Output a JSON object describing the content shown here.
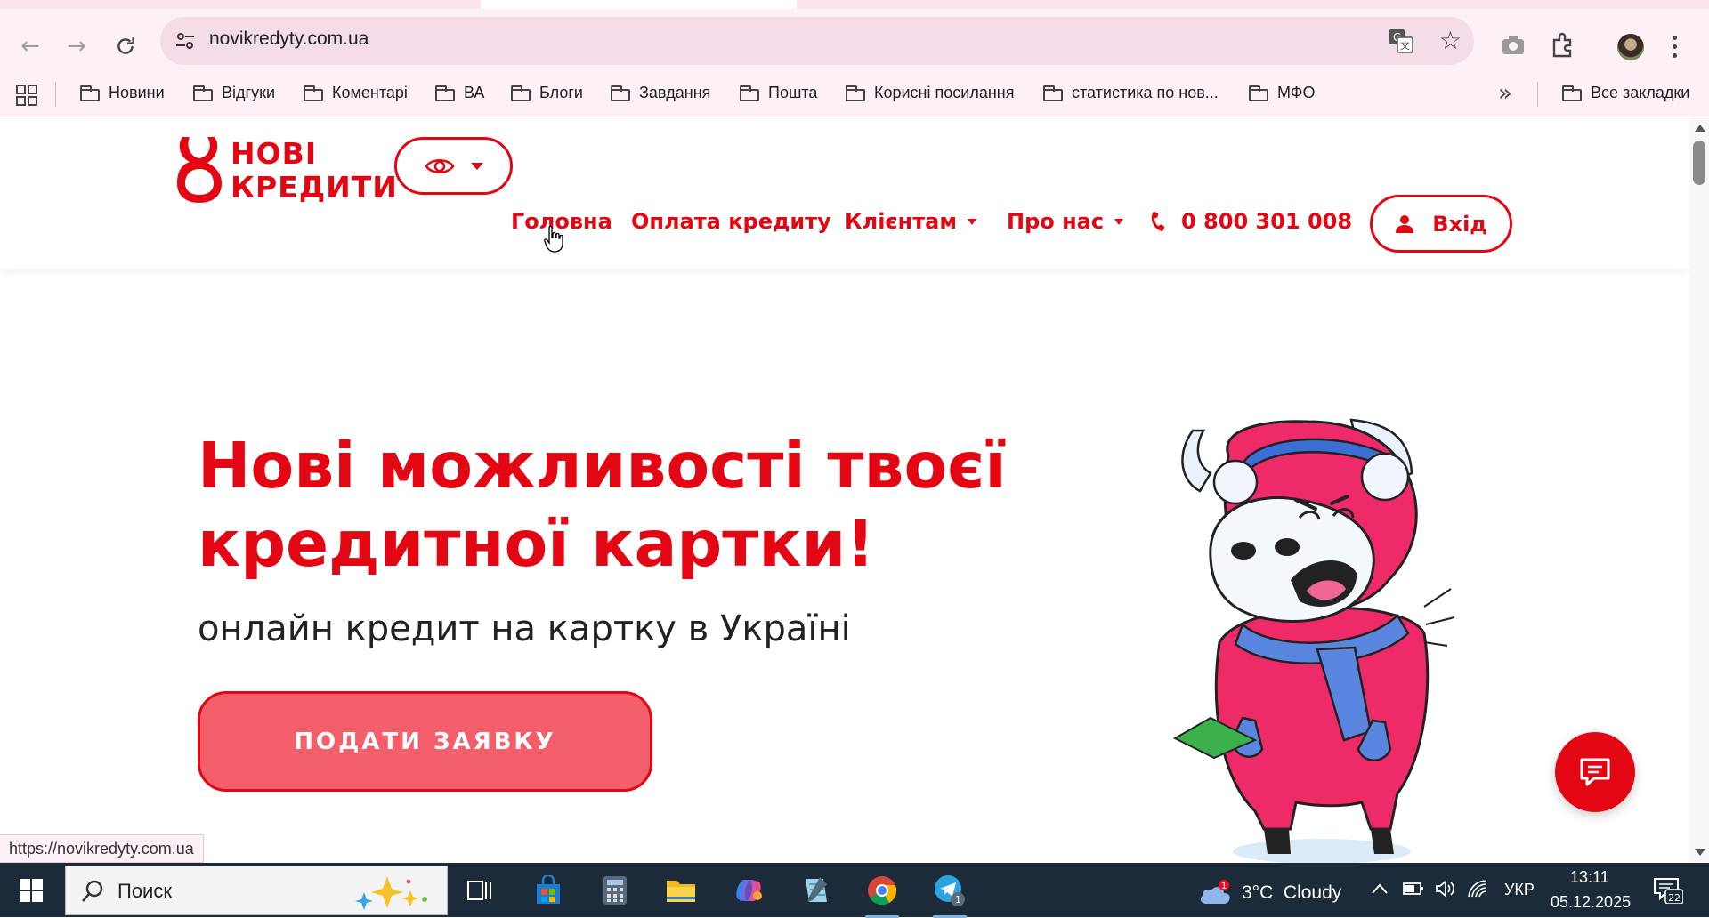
{
  "browser": {
    "url": "novikredyty.com.ua",
    "status_url": "https://novikredyty.com.ua",
    "bookmarks": [
      {
        "label": "Новини"
      },
      {
        "label": "Відгуки"
      },
      {
        "label": "Коментарі"
      },
      {
        "label": "ВА"
      },
      {
        "label": "Блоги"
      },
      {
        "label": "Завдання"
      },
      {
        "label": "Пошта"
      },
      {
        "label": "Корисні посилання"
      },
      {
        "label": "статистика по нов..."
      },
      {
        "label": "МФО"
      }
    ],
    "all_bookmarks": "Все закладки"
  },
  "site": {
    "logo_line1": "НОВІ",
    "logo_line2": "КРЕДИТИ",
    "nav": {
      "home": "Головна",
      "payment": "Оплата кредиту",
      "clients": "Клієнтам",
      "about": "Про нас",
      "phone": "0 800 301 008",
      "login": "Вхід"
    },
    "hero": {
      "title_line1": "Нові можливості твоєї",
      "title_line2": "кредитної картки!",
      "subtitle": "онлайн кредит на картку в Україні",
      "cta": "ПОДАТИ ЗАЯВКУ"
    },
    "colors": {
      "brand": "#e30613",
      "button": "#f25f6b"
    }
  },
  "taskbar": {
    "search_placeholder": "Поиск",
    "weather": "3°C  Cloudy",
    "weather_badge": "1",
    "language": "УКР",
    "time": "13:11",
    "date": "05.12.2025",
    "notifications": "22",
    "telegram_badge": "1"
  }
}
